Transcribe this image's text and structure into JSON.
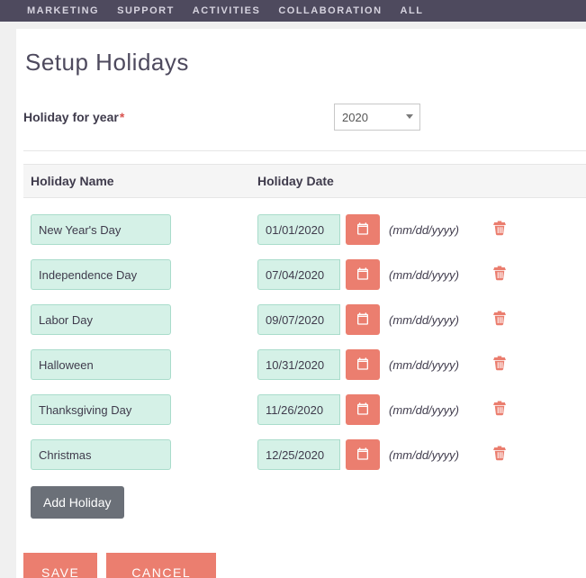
{
  "nav": {
    "marketing": "MARKETING",
    "support": "SUPPORT",
    "activities": "ACTIVITIES",
    "collaboration": "COLLABORATION",
    "all": "ALL"
  },
  "page_title": "Setup Holidays",
  "year_row": {
    "label": "Holiday for year",
    "required_mark": "*",
    "value": "2020"
  },
  "table": {
    "col_name": "Holiday Name",
    "col_date": "Holiday Date"
  },
  "date_hint": "(mm/dd/yyyy)",
  "holidays": [
    {
      "name": "New Year's Day",
      "date": "01/01/2020"
    },
    {
      "name": "Independence Day",
      "date": "07/04/2020"
    },
    {
      "name": "Labor Day",
      "date": "09/07/2020"
    },
    {
      "name": "Halloween",
      "date": "10/31/2020"
    },
    {
      "name": "Thanksgiving Day",
      "date": "11/26/2020"
    },
    {
      "name": "Christmas",
      "date": "12/25/2020"
    }
  ],
  "buttons": {
    "add_holiday": "Add Holiday",
    "save": "SAVE",
    "cancel": "CANCEL"
  }
}
